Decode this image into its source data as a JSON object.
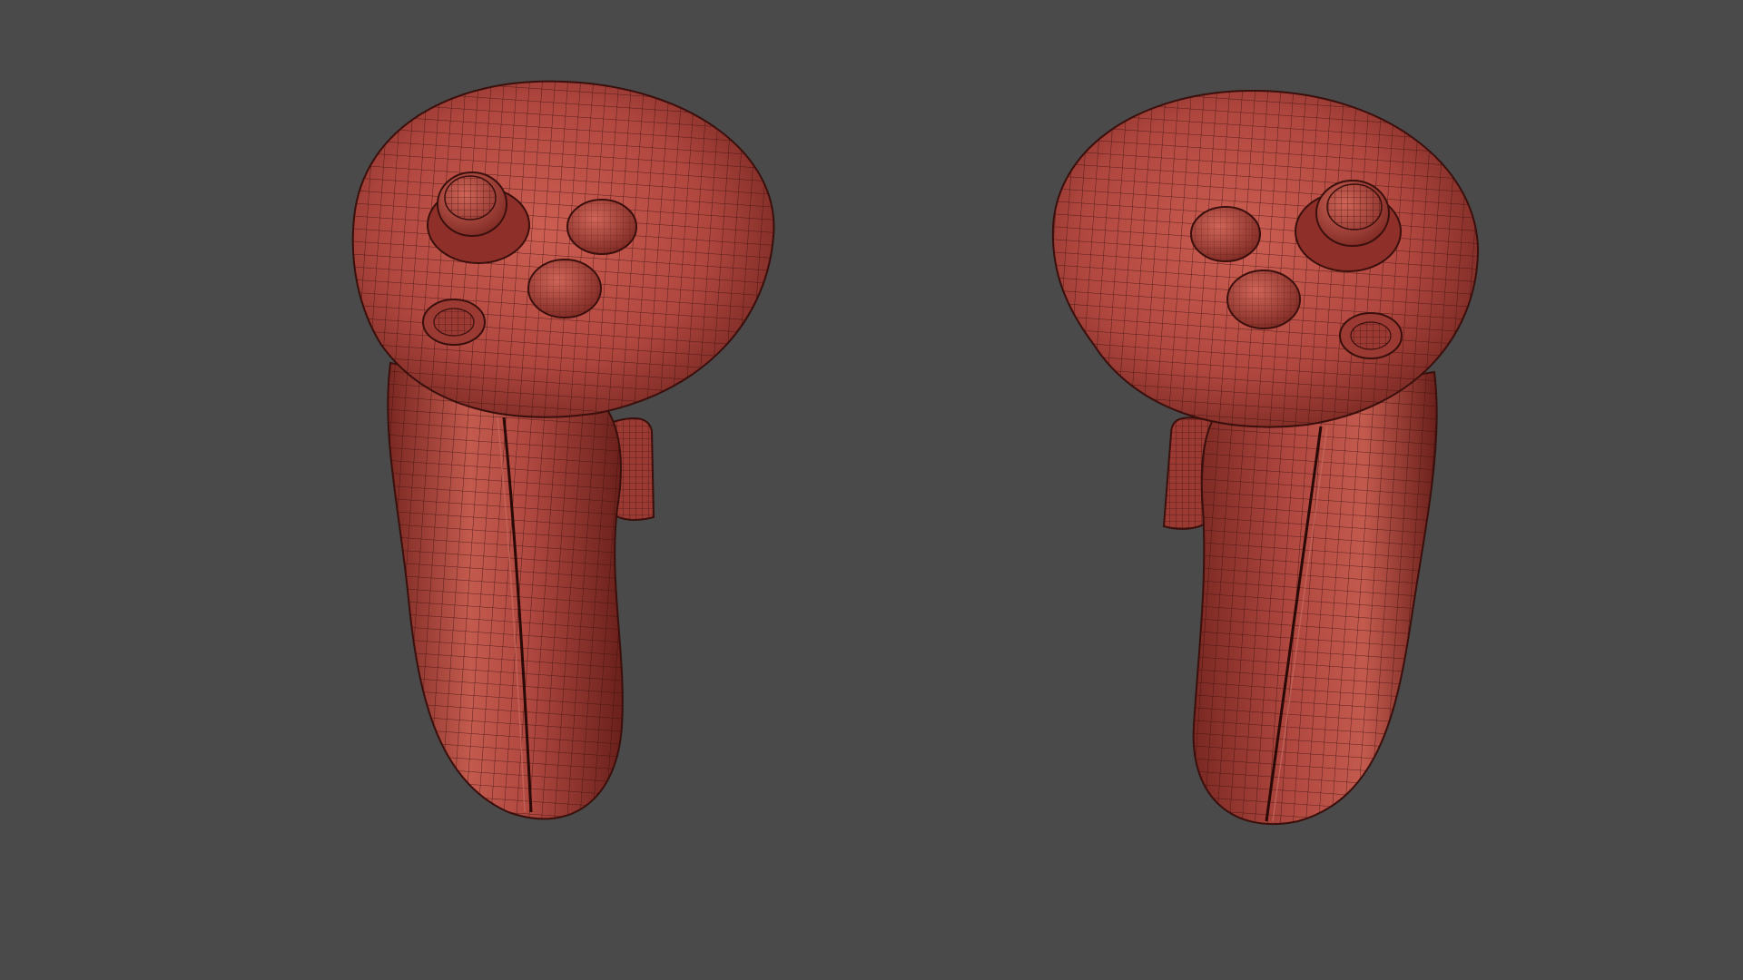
{
  "scene": {
    "background_color": "#4a4a4a",
    "material_base": "#b0473f",
    "material_light": "#d36a5c",
    "material_dark": "#5e1c18",
    "wire_color": "#3a0f0c",
    "objects": [
      {
        "name": "left-vr-controller",
        "icon": "vr-controller-left"
      },
      {
        "name": "right-vr-controller",
        "icon": "vr-controller-right"
      }
    ]
  }
}
